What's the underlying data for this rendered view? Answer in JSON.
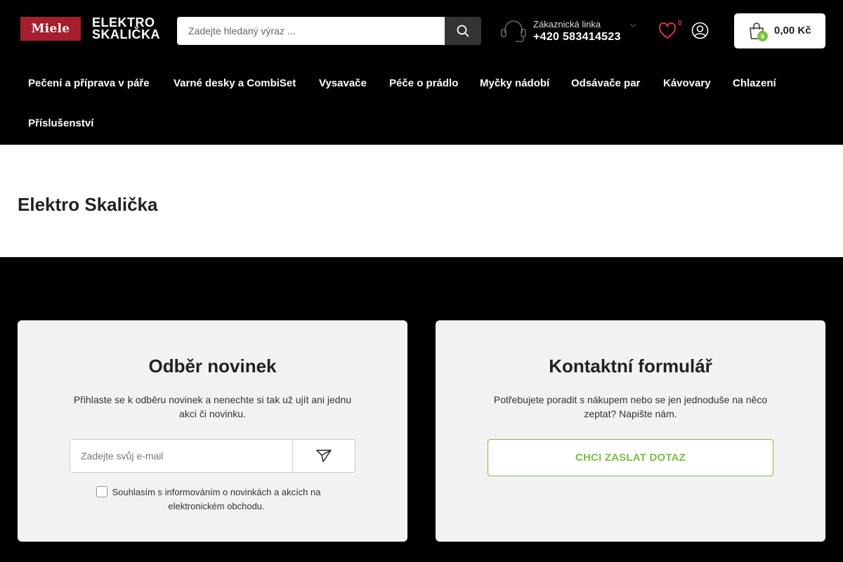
{
  "header": {
    "logo": {
      "brand_badge": "Miele",
      "text_line1": "ELEKTRO",
      "text_line2": "SKALIČKA"
    },
    "search": {
      "placeholder": "Zadejte hledaný výraz ...",
      "icon": "search-icon"
    },
    "hotline": {
      "label": "Zákaznická linka",
      "phone": "+420 583414523",
      "icon": "headset-icon"
    },
    "wishlist": {
      "count": "0",
      "icon": "heart-icon"
    },
    "account": {
      "icon": "user-icon"
    },
    "cart": {
      "count": "0",
      "total": "0,00 Kč",
      "icon": "shopping-bag-icon"
    }
  },
  "nav": {
    "items": [
      {
        "label": "Pečení a příprava v páře"
      },
      {
        "label": "Varné desky a CombiSet"
      },
      {
        "label": "Vysavače"
      },
      {
        "label": "Péče o prádlo"
      },
      {
        "label": "Myčky nádobí"
      },
      {
        "label": "Odsávače par"
      },
      {
        "label": "Kávovary"
      },
      {
        "label": "Chlazení"
      },
      {
        "label": "Příslušenství"
      }
    ]
  },
  "main": {
    "title": "Elektro Skalička"
  },
  "newsletter": {
    "title": "Odběr novinek",
    "text": "Přihlaste se k odběru novinek a nenechte si tak už ujít ani jednu akci či novinku.",
    "email_placeholder": "Zadejte svůj e-mail",
    "send_icon": "send-icon",
    "consent_text": "Souhlasím s informováním o novinkách a akcích na elektronickém obchodu."
  },
  "contact": {
    "title": "Kontaktní formulář",
    "text": "Potřebujete poradit s nákupem nebo se jen jednoduše na něco zeptat? Napište nám.",
    "button_label": "CHCI ZASLAT DOTAZ"
  },
  "colors": {
    "header_bg": "#000000",
    "miele_red": "#a51e2e",
    "accent_green": "#7ac142",
    "wishlist_red": "#e63946",
    "card_bg": "#f2f2f2"
  }
}
